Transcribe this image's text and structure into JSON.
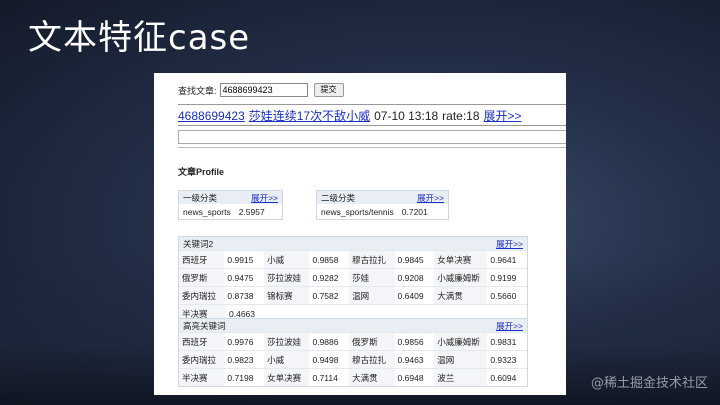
{
  "slide": {
    "title": "文本特征case",
    "watermark": "@稀土掘金技术社区"
  },
  "search": {
    "label": "查找文章:",
    "value": "4688699423",
    "submit": "提交"
  },
  "article": {
    "id": "4688699423",
    "title": "莎娃连续17次不敌小威",
    "time": "07-10 13:18",
    "rate": "rate:18",
    "expand": "展开>>"
  },
  "profile": {
    "title": "文章Profile",
    "category1": {
      "header": "一级分类",
      "expand": "展开>>",
      "name": "news_sports",
      "score": "2.5957"
    },
    "category2": {
      "header": "二级分类",
      "expand": "展开>>",
      "name": "news_sports/tennis",
      "score": "0.7201"
    }
  },
  "keywords": {
    "header": "关键词2",
    "expand": "展开>>",
    "rows": [
      [
        [
          "西班牙",
          "0.9915"
        ],
        [
          "小威",
          "0.9858"
        ],
        [
          "穆古拉扎",
          "0.9845"
        ],
        [
          "女单决赛",
          "0.9641"
        ]
      ],
      [
        [
          "俄罗斯",
          "0.9475"
        ],
        [
          "莎拉波娃",
          "0.9282"
        ],
        [
          "莎娃",
          "0.9208"
        ],
        [
          "小威廉姆斯",
          "0.9199"
        ]
      ],
      [
        [
          "委内瑞拉",
          "0.8738"
        ],
        [
          "锦标赛",
          "0.7582"
        ],
        [
          "温网",
          "0.6409"
        ],
        [
          "大满贯",
          "0.5660"
        ]
      ],
      [
        [
          "半决赛",
          "0.4663"
        ]
      ]
    ]
  },
  "highlights": {
    "header": "高亮关键词",
    "expand": "展开>>",
    "rows": [
      [
        [
          "西班牙",
          "0.9976"
        ],
        [
          "莎拉波娃",
          "0.9886"
        ],
        [
          "俄罗斯",
          "0.9856"
        ],
        [
          "小威廉姆斯",
          "0.9831"
        ]
      ],
      [
        [
          "委内瑞拉",
          "0.9823"
        ],
        [
          "小威",
          "0.9498"
        ],
        [
          "穆古拉扎",
          "0.9463"
        ],
        [
          "温网",
          "0.9323"
        ]
      ],
      [
        [
          "半决赛",
          "0.7198"
        ],
        [
          "女单决赛",
          "0.7114"
        ],
        [
          "大满贯",
          "0.6948"
        ],
        [
          "波兰",
          "0.6094"
        ]
      ]
    ]
  }
}
